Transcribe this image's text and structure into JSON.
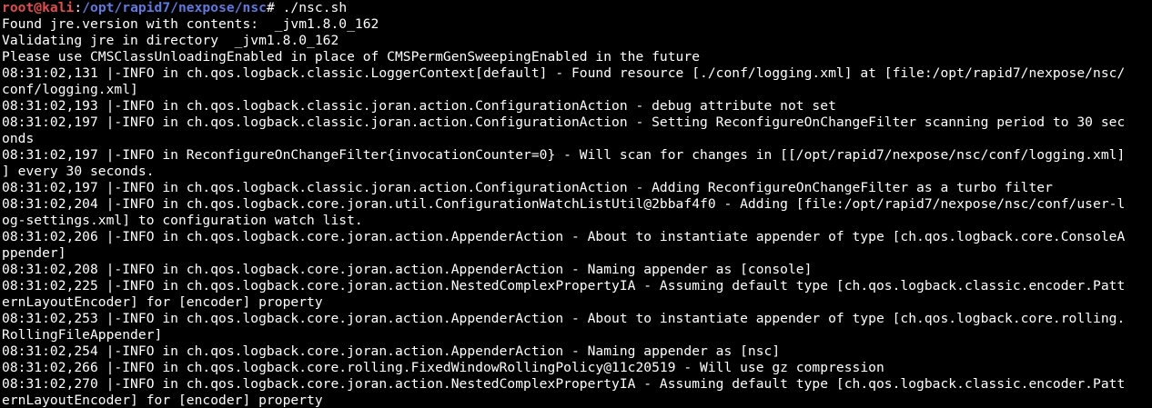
{
  "prompt": {
    "user_host": "root@kali",
    "separator": ":",
    "path": "/opt/rapid7/nexpose/nsc",
    "symbol": "# ",
    "command": "./nsc.sh"
  },
  "output_lines": [
    "Found jre.version with contents:  _jvm1.8.0_162",
    "Validating jre in directory  _jvm1.8.0_162",
    "Please use CMSClassUnloadingEnabled in place of CMSPermGenSweepingEnabled in the future",
    "08:31:02,131 |-INFO in ch.qos.logback.classic.LoggerContext[default] - Found resource [./conf/logging.xml] at [file:/opt/rapid7/nexpose/nsc/",
    "conf/logging.xml]",
    "08:31:02,193 |-INFO in ch.qos.logback.classic.joran.action.ConfigurationAction - debug attribute not set",
    "08:31:02,197 |-INFO in ch.qos.logback.classic.joran.action.ConfigurationAction - Setting ReconfigureOnChangeFilter scanning period to 30 sec",
    "onds",
    "08:31:02,197 |-INFO in ReconfigureOnChangeFilter{invocationCounter=0} - Will scan for changes in [[/opt/rapid7/nexpose/nsc/conf/logging.xml]",
    "] every 30 seconds.",
    "08:31:02,197 |-INFO in ch.qos.logback.classic.joran.action.ConfigurationAction - Adding ReconfigureOnChangeFilter as a turbo filter",
    "08:31:02,204 |-INFO in ch.qos.logback.core.joran.util.ConfigurationWatchListUtil@2bbaf4f0 - Adding [file:/opt/rapid7/nexpose/nsc/conf/user-l",
    "og-settings.xml] to configuration watch list.",
    "08:31:02,206 |-INFO in ch.qos.logback.core.joran.action.AppenderAction - About to instantiate appender of type [ch.qos.logback.core.ConsoleA",
    "ppender]",
    "08:31:02,208 |-INFO in ch.qos.logback.core.joran.action.AppenderAction - Naming appender as [console]",
    "08:31:02,225 |-INFO in ch.qos.logback.core.joran.action.NestedComplexPropertyIA - Assuming default type [ch.qos.logback.classic.encoder.Patt",
    "ernLayoutEncoder] for [encoder] property",
    "08:31:02,253 |-INFO in ch.qos.logback.core.joran.action.AppenderAction - About to instantiate appender of type [ch.qos.logback.core.rolling.",
    "RollingFileAppender]",
    "08:31:02,254 |-INFO in ch.qos.logback.core.joran.action.AppenderAction - Naming appender as [nsc]",
    "08:31:02,266 |-INFO in ch.qos.logback.core.rolling.FixedWindowRollingPolicy@11c20519 - Will use gz compression",
    "08:31:02,270 |-INFO in ch.qos.logback.core.joran.action.NestedComplexPropertyIA - Assuming default type [ch.qos.logback.classic.encoder.Patt",
    "ernLayoutEncoder] for [encoder] property"
  ],
  "colors": {
    "background": "#000000",
    "text": "#ffffff",
    "prompt_user": "#e74b4b",
    "prompt_path": "#5c7be0"
  }
}
